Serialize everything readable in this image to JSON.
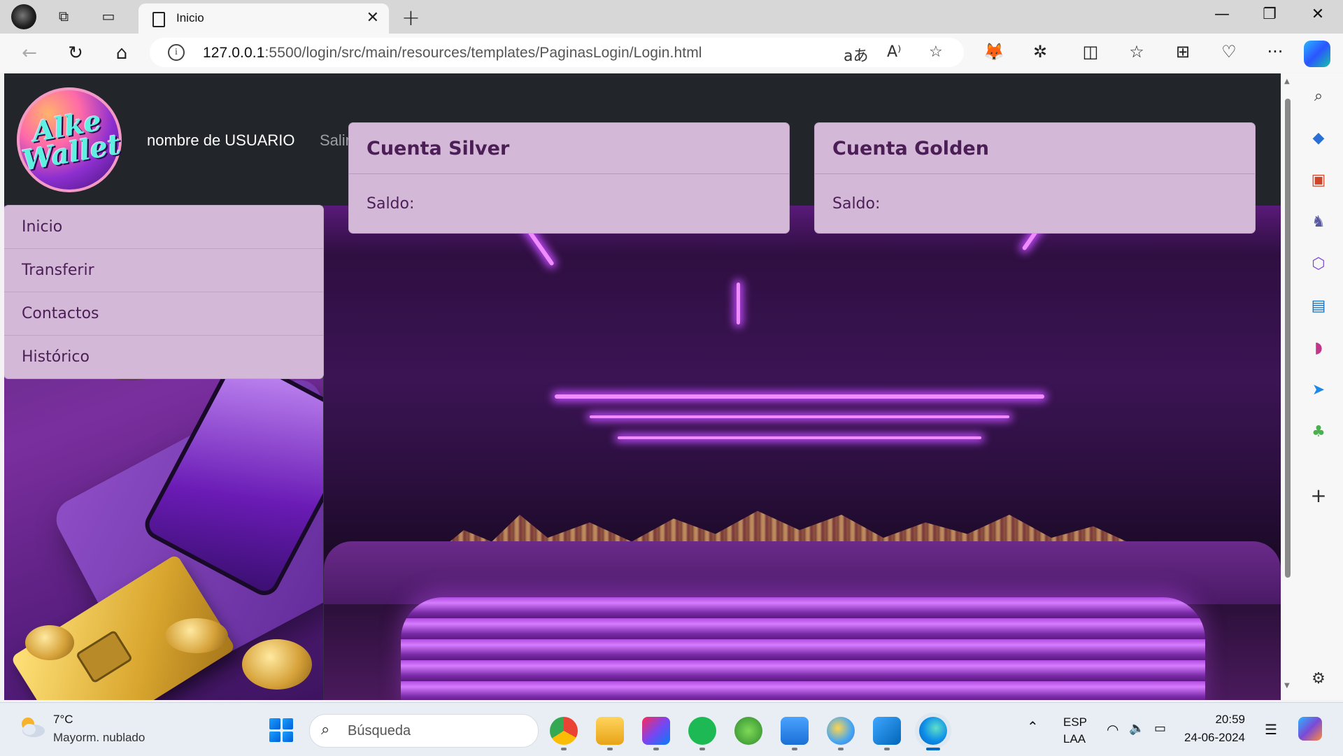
{
  "browser": {
    "tab_title": "Inicio",
    "url_host": "127.0.0.1",
    "url_path": ":5500/login/src/main/resources/templates/PaginasLogin/Login.html"
  },
  "site": {
    "logo_text": "Alke Wallet",
    "username": "nombre de USUARIO",
    "logout_label": "Salir"
  },
  "menu": {
    "items": [
      {
        "label": "Inicio"
      },
      {
        "label": "Transferir"
      },
      {
        "label": "Contactos"
      },
      {
        "label": "Histórico"
      }
    ]
  },
  "accounts": [
    {
      "title": "Cuenta Silver",
      "balance_label": "Saldo:"
    },
    {
      "title": "Cuenta Golden",
      "balance_label": "Saldo:"
    }
  ],
  "taskbar": {
    "weather_temp": "7°C",
    "weather_desc": "Mayorm. nublado",
    "search_placeholder": "Búsqueda",
    "lang_top": "ESP",
    "lang_bottom": "LAA",
    "time": "20:59",
    "date": "24-06-2024"
  },
  "colors": {
    "header_bg": "#222529",
    "card_bg": "#d4b8d7",
    "card_text": "#4b1f56"
  }
}
